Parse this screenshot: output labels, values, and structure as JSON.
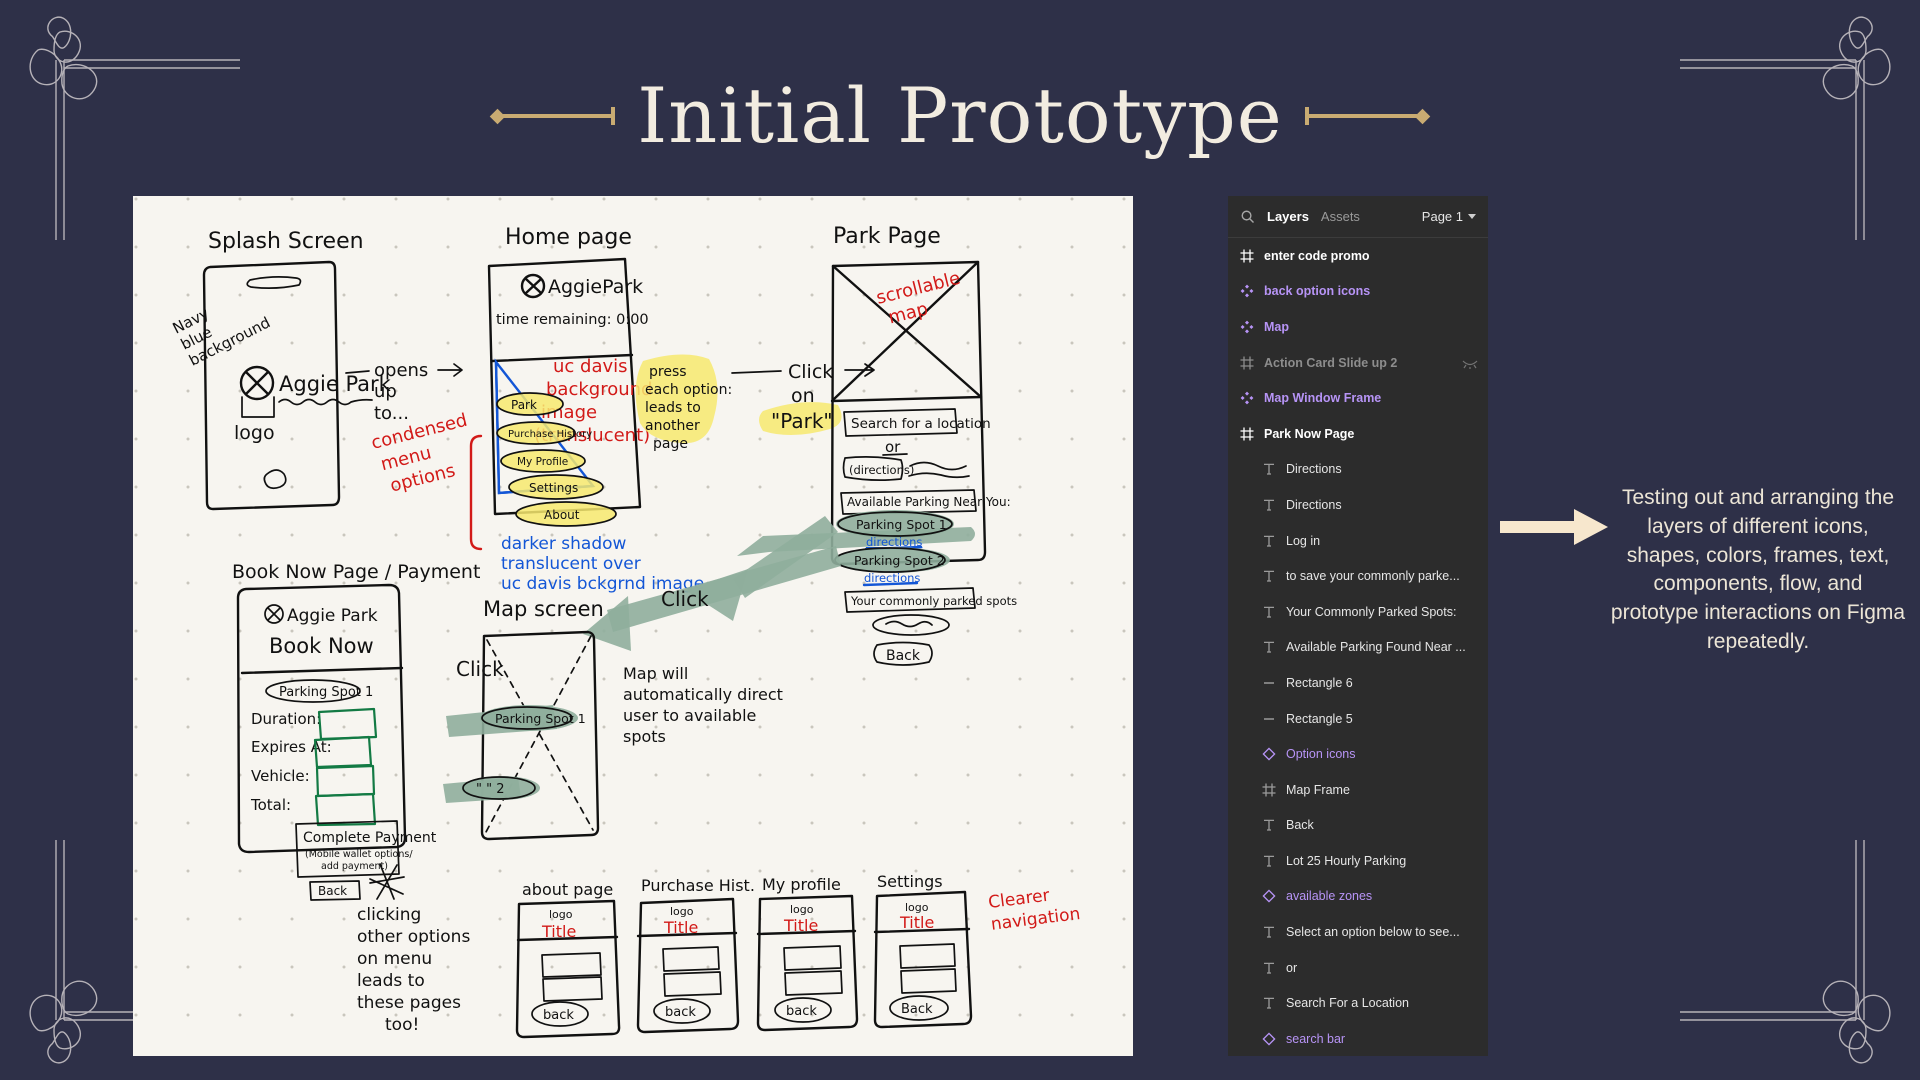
{
  "slide": {
    "title": "Initial Prototype",
    "background_color": "#2e3048",
    "accent_color": "#c9ab72",
    "caption": "Testing out and arranging the layers of different icons, shapes, colors, frames, text, components, flow, and prototype interactions on Figma repeatedly."
  },
  "figma": {
    "search_icon": "search-icon",
    "tab_layers": "Layers",
    "tab_assets": "Assets",
    "page_selector": "Page 1",
    "chevron_icon": "chevron-down-icon",
    "layers": [
      {
        "label": "enter code promo",
        "type": "frame",
        "indent": false,
        "hidden": false,
        "icon": "frame-icon"
      },
      {
        "label": "back option icons",
        "type": "component",
        "indent": false,
        "hidden": false,
        "icon": "component-icon"
      },
      {
        "label": "Map",
        "type": "component",
        "indent": false,
        "hidden": false,
        "icon": "component-icon"
      },
      {
        "label": "Action Card Slide up 2",
        "type": "frame-dim",
        "indent": false,
        "hidden": true,
        "icon": "frame-icon"
      },
      {
        "label": "Map Window Frame",
        "type": "component",
        "indent": false,
        "hidden": false,
        "icon": "component-icon"
      },
      {
        "label": "Park Now Page",
        "type": "frame",
        "indent": false,
        "hidden": false,
        "icon": "frame-icon"
      },
      {
        "label": "Directions",
        "type": "text",
        "indent": true,
        "hidden": false,
        "icon": "text-icon"
      },
      {
        "label": "Directions",
        "type": "text",
        "indent": true,
        "hidden": false,
        "icon": "text-icon"
      },
      {
        "label": "Log in",
        "type": "text",
        "indent": true,
        "hidden": false,
        "icon": "text-icon"
      },
      {
        "label": "to save your commonly parke...",
        "type": "text",
        "indent": true,
        "hidden": false,
        "icon": "text-icon"
      },
      {
        "label": "Your Commonly Parked Spots:",
        "type": "text",
        "indent": true,
        "hidden": false,
        "icon": "text-icon"
      },
      {
        "label": "Available Parking Found Near ...",
        "type": "text",
        "indent": true,
        "hidden": false,
        "icon": "text-icon"
      },
      {
        "label": "Rectangle 6",
        "type": "text",
        "indent": true,
        "hidden": false,
        "icon": "line-icon"
      },
      {
        "label": "Rectangle 5",
        "type": "text",
        "indent": true,
        "hidden": false,
        "icon": "line-icon"
      },
      {
        "label": "Option icons",
        "type": "instance",
        "indent": true,
        "hidden": false,
        "icon": "instance-icon"
      },
      {
        "label": "Map Frame",
        "type": "text",
        "indent": true,
        "hidden": false,
        "icon": "frame-icon"
      },
      {
        "label": "Back",
        "type": "text",
        "indent": true,
        "hidden": false,
        "icon": "text-icon"
      },
      {
        "label": "Lot 25 Hourly Parking",
        "type": "text",
        "indent": true,
        "hidden": false,
        "icon": "text-icon"
      },
      {
        "label": "available zones",
        "type": "instance",
        "indent": true,
        "hidden": false,
        "icon": "instance-icon"
      },
      {
        "label": "Select an option below to see...",
        "type": "text",
        "indent": true,
        "hidden": false,
        "icon": "text-icon"
      },
      {
        "label": "or",
        "type": "text",
        "indent": true,
        "hidden": false,
        "icon": "text-icon"
      },
      {
        "label": "Search For a Location",
        "type": "text",
        "indent": true,
        "hidden": false,
        "icon": "text-icon"
      },
      {
        "label": "search bar",
        "type": "instance",
        "indent": true,
        "hidden": false,
        "icon": "instance-icon"
      }
    ]
  },
  "sketch": {
    "splash": {
      "heading": "Splash Screen",
      "app_name": "Aggie Park",
      "logo_label": "logo",
      "note_background": "Navy blue background"
    },
    "home": {
      "heading": "Home page",
      "app_name": "AggiePark",
      "timer": "time remaining: 0:00",
      "note_bg_image": "uc davis background image (translucent)",
      "menu_options": [
        "Park",
        "Purchase History",
        "My Profile",
        "Settings",
        "About"
      ],
      "note_condensed": "condensed menu options",
      "note_shadow": "darker shadow translucent over uc davis bckgrnd image",
      "note_opens": "opens up to...",
      "note_press": "press each option: leads to another page"
    },
    "park": {
      "heading": "Park Page",
      "note_map": "scrollable map",
      "search_field": "Search for a location",
      "or_text": "or",
      "directions_field": "(directions)",
      "available_header": "Available Parking Near You:",
      "spot_1": "Parking Spot 1",
      "spot_1_link": "directions",
      "spot_2": "Parking Spot 2",
      "spot_2_link": "directions",
      "commonly_parked": "Your commonly parked spots",
      "back_button": "Back",
      "note_click": "Click on \"Park\""
    },
    "book": {
      "heading": "Book Now Page / Payment",
      "app_name": "Aggie Park",
      "page_title": "Book Now",
      "spot_pill": "Parking Spot 1",
      "fields": [
        "Duration:",
        "Expires At:",
        "Vehicle:",
        "Total:"
      ],
      "pay_button": "Complete Payment",
      "pay_sub": "(Mobile wallet options/ add payment)",
      "back_button": "Back"
    },
    "map_screen": {
      "heading": "Map screen",
      "spot_1": "Parking Spot 1",
      "spot_2": "\" \" 2",
      "note": "Map will automatically direct user to available spots"
    },
    "click_labels": [
      "Click",
      "Click"
    ],
    "bottom_note": "clicking other options on menu leads to these pages too!",
    "bottom_note_icon": "star-icon",
    "clearer_nav_note": "Clearer navigation",
    "mini_pages": [
      {
        "heading": "about page",
        "logo": "logo",
        "title": "Title",
        "back": "back"
      },
      {
        "heading": "Purchase Hist.",
        "logo": "logo",
        "title": "Title",
        "back": "back"
      },
      {
        "heading": "My profile",
        "logo": "logo",
        "title": "Title",
        "back": "back"
      },
      {
        "heading": "Settings",
        "logo": "logo",
        "title": "Title",
        "back": "Back"
      }
    ]
  }
}
